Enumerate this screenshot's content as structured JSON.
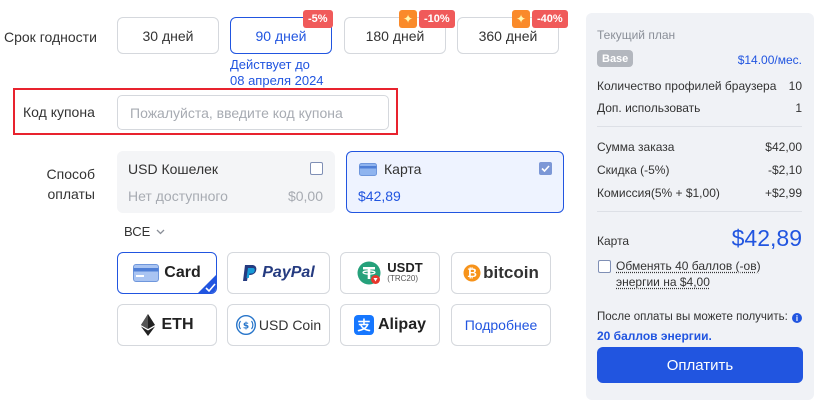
{
  "period": {
    "label": "Срок годности",
    "options": [
      {
        "label": "30 дней",
        "badge": ""
      },
      {
        "label": "90 дней",
        "badge": "-5%"
      },
      {
        "label": "180 дней",
        "badge": "-10%"
      },
      {
        "label": "360 дней",
        "badge": "-40%"
      }
    ],
    "valid_line1": "Действует до",
    "valid_line2": "08 апреля 2024"
  },
  "coupon": {
    "label": "Код купона",
    "placeholder": "Пожалуйста, введите код купона",
    "value": ""
  },
  "payment": {
    "label_line1": "Способ",
    "label_line2": "оплаты",
    "wallet": {
      "title": "USD Кошелек",
      "subtitle": "Нет доступного",
      "amount": "$0,00"
    },
    "card": {
      "title": "Карта",
      "amount": "$42,89"
    },
    "filter": "ВСЕ",
    "methods": [
      "Card",
      "PayPal",
      "USDT",
      "TRC20",
      "bitcoin",
      "ETH",
      "USD Coin",
      "Alipay",
      "Подробнее"
    ]
  },
  "summary": {
    "heading": "Текущий план",
    "plan_name": "Base",
    "plan_price": "$14.00/мес.",
    "profiles_label": "Количество профилей браузера",
    "profiles_value": "10",
    "extra_label": "Доп. использовать",
    "extra_value": "1",
    "order_label": "Сумма заказа",
    "order_value": "$42,00",
    "discount_label": "Скидка (-5%)",
    "discount_value": "-$2,10",
    "fee_label": "Комиссия(5% + $1,00)",
    "fee_value": "+$2,99",
    "total_label": "Карта",
    "total_value": "$42,89",
    "exchange_line1": "Обменять 40 баллов (-ов)",
    "exchange_line2": "энергии на $4,00",
    "after_text": "После оплаты вы можете получить:",
    "energy_bonus": "20 баллов энергии.",
    "pay_button": "Оплатить"
  },
  "colors": {
    "accent": "#2155e0",
    "badge": "#f05a5a",
    "highlight_border": "#e8232e",
    "panel_bg": "#f0f2f6"
  }
}
